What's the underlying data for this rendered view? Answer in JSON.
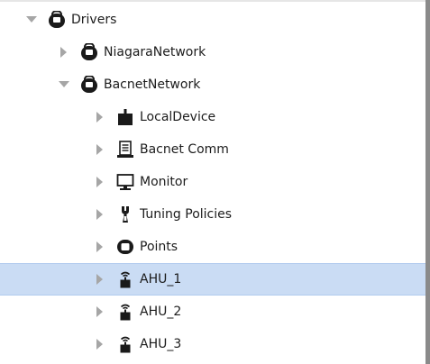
{
  "tree": {
    "root": {
      "label": "Drivers",
      "expanded": true,
      "icon": "driver-container-icon"
    },
    "children": [
      {
        "label": "NiagaraNetwork",
        "expanded": false,
        "icon": "network-icon"
      },
      {
        "label": "BacnetNetwork",
        "expanded": true,
        "icon": "network-icon"
      }
    ],
    "bacnet_children": [
      {
        "label": "LocalDevice",
        "icon": "device-icon"
      },
      {
        "label": "Bacnet Comm",
        "icon": "comm-icon"
      },
      {
        "label": "Monitor",
        "icon": "monitor-icon"
      },
      {
        "label": "Tuning Policies",
        "icon": "tuning-icon"
      },
      {
        "label": "Points",
        "icon": "points-icon"
      },
      {
        "label": "AHU_1",
        "icon": "device-wireless-icon",
        "selected": true
      },
      {
        "label": "AHU_2",
        "icon": "device-wireless-icon"
      },
      {
        "label": "AHU_3",
        "icon": "device-wireless-icon"
      }
    ]
  },
  "colors": {
    "selection": "#cadcf4",
    "arrow": "#a6a6a6",
    "icon": "#1a1a1a"
  }
}
